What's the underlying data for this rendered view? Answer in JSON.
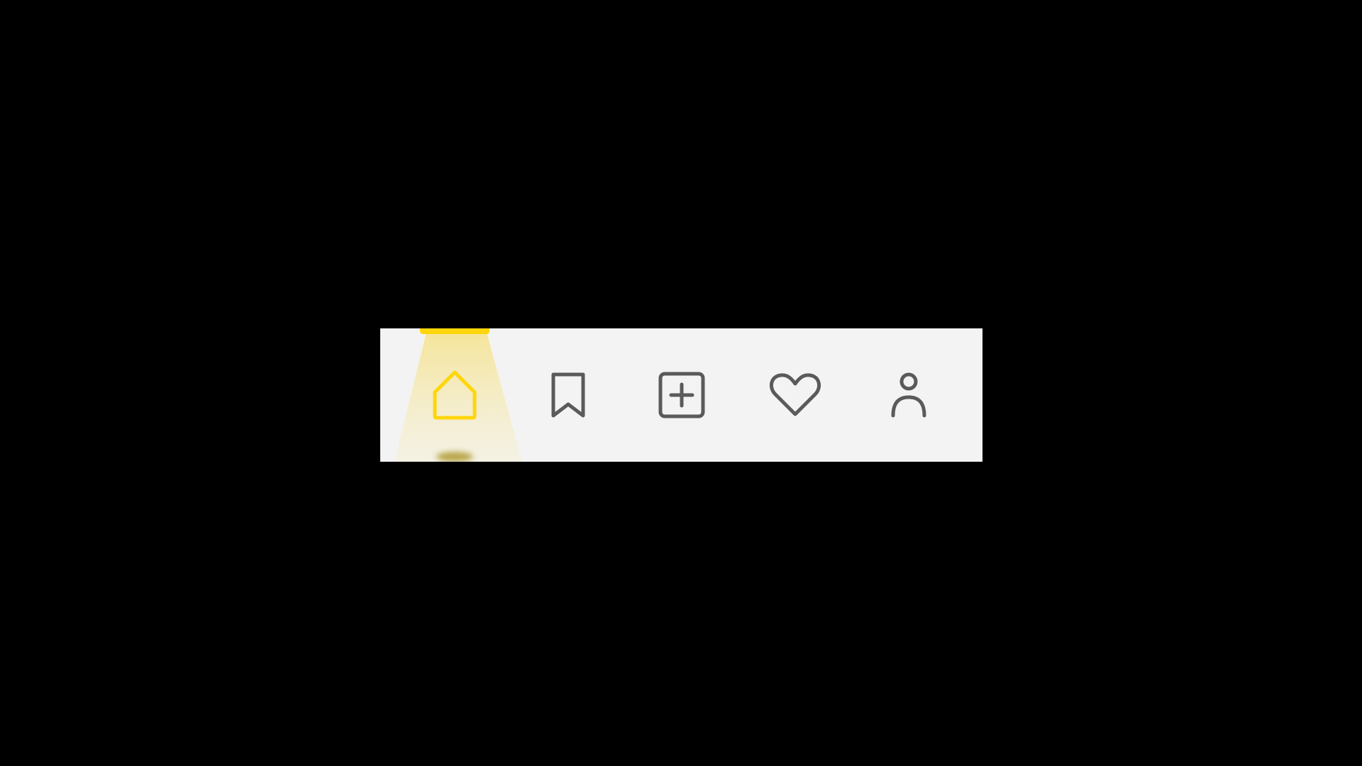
{
  "nav": {
    "active_index": 0,
    "items": [
      {
        "name": "home",
        "icon": "home-icon",
        "active": true
      },
      {
        "name": "bookmark",
        "icon": "bookmark-icon",
        "active": false
      },
      {
        "name": "add",
        "icon": "add-square-icon",
        "active": false
      },
      {
        "name": "favorites",
        "icon": "heart-icon",
        "active": false
      },
      {
        "name": "profile",
        "icon": "user-icon",
        "active": false
      }
    ]
  },
  "colors": {
    "background": "#000000",
    "navbar": "#f3f3f3",
    "active": "#ffd60a",
    "inactive": "#5a5a5a"
  }
}
